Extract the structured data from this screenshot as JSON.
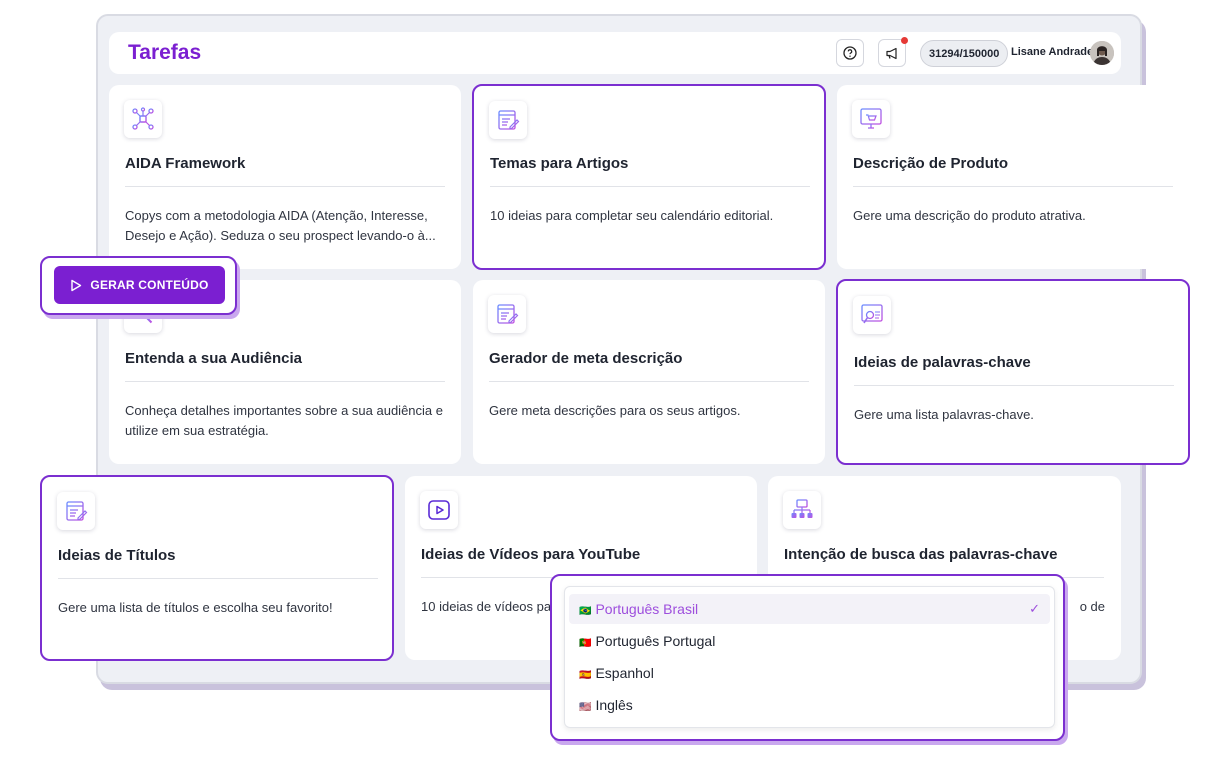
{
  "header": {
    "title": "Tarefas",
    "credits": "31294/150000",
    "username": "Lisane Andrade"
  },
  "cards": [
    {
      "title": "AIDA Framework",
      "desc": "Copys com a metodologia AIDA (Atenção, Interesse, Desejo e Ação). Seduza o seu prospect levando-o à...",
      "icon": "network-icon"
    },
    {
      "title": "Temas para Artigos",
      "desc": "10 ideias para completar seu calendário editorial.",
      "icon": "document-edit-icon"
    },
    {
      "title": "Descrição de Produto",
      "desc": "Gere uma descrição do produto atrativa.",
      "icon": "shopping-cart-icon"
    },
    {
      "title": "Entenda a sua Audiência",
      "desc": "Conheça detalhes importantes sobre a sua audiência e utilize em sua estratégia.",
      "icon": "audience-icon"
    },
    {
      "title": "Gerador de meta descrição",
      "desc": "Gere meta descrições para os seus artigos.",
      "icon": "document-edit-icon"
    },
    {
      "title": "Ideias de palavras-chave",
      "desc": "Gere uma lista palavras-chave.",
      "icon": "keyword-search-icon"
    },
    {
      "title": "Ideias de Títulos",
      "desc": "Gere uma lista de títulos e escolha seu favorito!",
      "icon": "document-edit-icon"
    },
    {
      "title": "Ideias de Vídeos para YouTube",
      "desc": "10 ideias de vídeos pa",
      "icon": "play-icon"
    },
    {
      "title": "Intenção de busca das palavras-chave",
      "desc": "o de",
      "icon": "sitemap-icon"
    }
  ],
  "gerar_button": {
    "label": "GERAR CONTEÚDO"
  },
  "languages": {
    "selected": "Português Brasil",
    "options": [
      {
        "label": "Português Brasil",
        "flag": "🇧🇷"
      },
      {
        "label": "Português Portugal",
        "flag": "🇵🇹"
      },
      {
        "label": "Espanhol",
        "flag": "🇪🇸"
      },
      {
        "label": "Inglês",
        "flag": "🇺🇸"
      }
    ]
  },
  "colors": {
    "accent": "#7b1fd1",
    "highlight_border": "#7b2fd0",
    "selected_text": "#9d4edd",
    "background": "#eef0f5"
  }
}
